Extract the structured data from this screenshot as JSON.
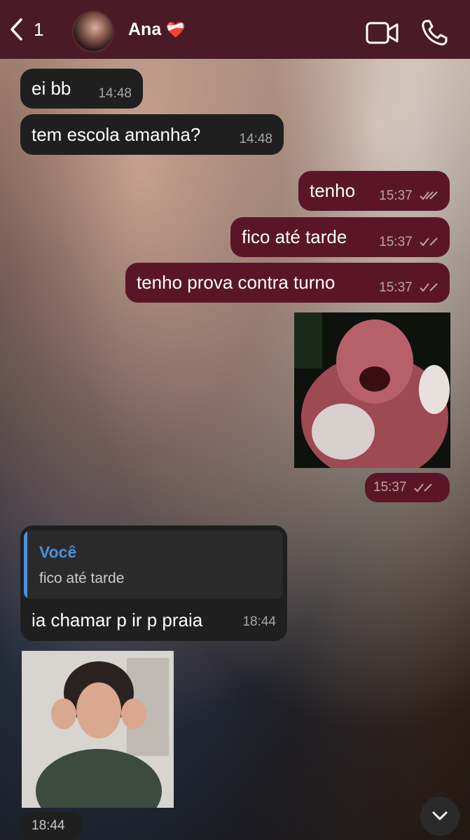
{
  "header": {
    "back_count": "1",
    "contact_name": "Ana",
    "contact_emoji": "❤️‍🩹"
  },
  "messages": [
    {
      "text": "ei bb",
      "time": "14:48"
    },
    {
      "text": "tem escola amanha?",
      "time": "14:48"
    },
    {
      "text": "tenho",
      "time": "15:37"
    },
    {
      "text": "fico até tarde",
      "time": "15:37"
    },
    {
      "text": "tenho prova contra turno",
      "time": "15:37"
    },
    {
      "time": "15:37"
    },
    {
      "reply_author": "Você",
      "reply_text": "fico até tarde",
      "text": "ia chamar p ir p praia",
      "time": "18:44"
    },
    {
      "time": "18:44"
    }
  ],
  "colors": {
    "header_bg": "#4a1a26",
    "outgoing_bubble": "#5a1627",
    "incoming_bubble": "#1f1f1f",
    "reply_accent": "#4a90e2"
  },
  "icons": [
    "chevron-left-icon",
    "video-camera-icon",
    "phone-icon",
    "double-check-icon",
    "chevron-down-icon"
  ]
}
